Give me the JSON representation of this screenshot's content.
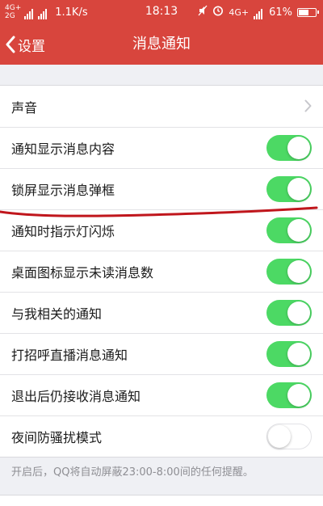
{
  "status_bar": {
    "network_top": "4G+",
    "network_bottom": "2G",
    "speed": "1.1K/s",
    "time": "18:13",
    "network_right": "4G+",
    "battery_percent": "61%",
    "battery_level": 0.61
  },
  "nav": {
    "back_label": "设置",
    "title": "消息通知"
  },
  "settings": [
    {
      "label": "声音",
      "type": "chevron"
    },
    {
      "label": "通知显示消息内容",
      "type": "toggle",
      "on": true
    },
    {
      "label": "锁屏显示消息弹框",
      "type": "toggle",
      "on": true
    },
    {
      "label": "通知时指示灯闪烁",
      "type": "toggle",
      "on": true
    },
    {
      "label": "桌面图标显示未读消息数",
      "type": "toggle",
      "on": true
    },
    {
      "label": "与我相关的通知",
      "type": "toggle",
      "on": true
    },
    {
      "label": "打招呼直播消息通知",
      "type": "toggle",
      "on": true
    },
    {
      "label": "退出后仍接收消息通知",
      "type": "toggle",
      "on": true
    },
    {
      "label": "夜间防骚扰模式",
      "type": "toggle",
      "on": false
    }
  ],
  "footer_note": "开启后，QQ将自动屏蔽23:00-8:00间的任何提醒。",
  "colors": {
    "header": "#d8453d",
    "toggle_on": "#4cd964",
    "annotation_stroke": "#c0161c"
  }
}
